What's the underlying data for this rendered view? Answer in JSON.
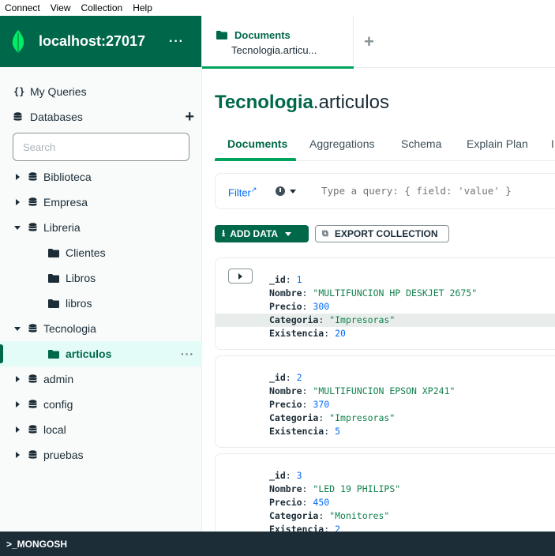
{
  "menubar": [
    "Connect",
    "View",
    "Collection",
    "Help"
  ],
  "connection": {
    "title": "localhost:27017",
    "more": "···"
  },
  "sidebar": {
    "my_queries": "My Queries",
    "databases": "Databases",
    "search_placeholder": "Search",
    "tree": [
      {
        "label": "Biblioteca",
        "type": "db",
        "expanded": false
      },
      {
        "label": "Empresa",
        "type": "db",
        "expanded": false
      },
      {
        "label": "Libreria",
        "type": "db",
        "expanded": true
      },
      {
        "label": "Clientes",
        "type": "collection"
      },
      {
        "label": "Libros",
        "type": "collection"
      },
      {
        "label": "libros",
        "type": "collection"
      },
      {
        "label": "Tecnologia",
        "type": "db",
        "expanded": true
      },
      {
        "label": "articulos",
        "type": "collection",
        "active": true
      },
      {
        "label": "admin",
        "type": "db",
        "expanded": false
      },
      {
        "label": "config",
        "type": "db",
        "expanded": false
      },
      {
        "label": "local",
        "type": "db",
        "expanded": false
      },
      {
        "label": "pruebas",
        "type": "db",
        "expanded": false
      }
    ]
  },
  "tab": {
    "title": "Documents",
    "subtitle": "Tecnologia.articu...",
    "new_tab": "+"
  },
  "namespace": {
    "db": "Tecnologia",
    "collection": ".articulos"
  },
  "subtabs": [
    "Documents",
    "Aggregations",
    "Schema",
    "Explain Plan",
    "I"
  ],
  "filter": {
    "label": "Filter",
    "placeholder": "Type a query: { field: 'value' }"
  },
  "buttons": {
    "add_data": "ADD DATA",
    "export": "EXPORT COLLECTION"
  },
  "documents": [
    {
      "_id": "1",
      "Nombre": "\"MULTIFUNCION HP DESKJET 2675\"",
      "Precio": "300",
      "Categoria": "\"Impresoras\"",
      "Existencia": "20"
    },
    {
      "_id": "2",
      "Nombre": "\"MULTIFUNCION EPSON XP241\"",
      "Precio": "370",
      "Categoria": "\"Impresoras\"",
      "Existencia": "5"
    },
    {
      "_id": "3",
      "Nombre": "\"LED 19 PHILIPS\"",
      "Precio": "450",
      "Categoria": "\"Monitores\"",
      "Existencia": "2"
    }
  ],
  "mongosh": ">_MONGOSH",
  "colors": {
    "brand": "#00684a",
    "accent": "#00a35c",
    "link": "#016bf8",
    "dark": "#1c2d38"
  }
}
